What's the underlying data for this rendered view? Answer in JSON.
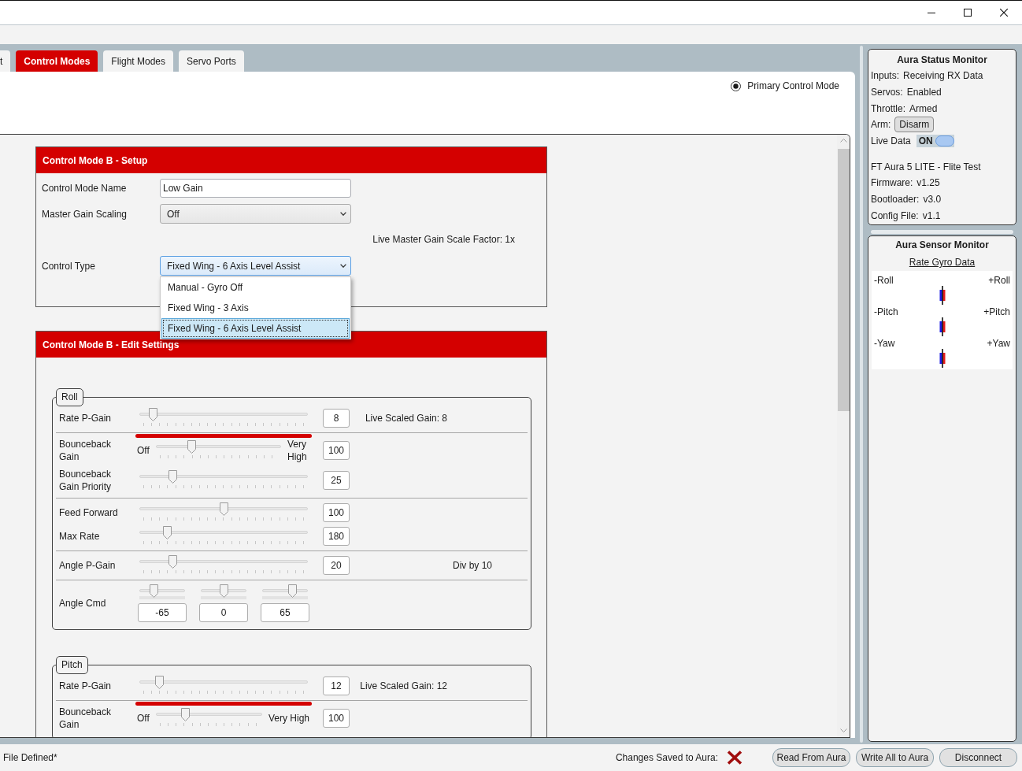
{
  "tabs": [
    {
      "label": "t",
      "selected": false
    },
    {
      "label": "Control Modes",
      "selected": true
    },
    {
      "label": "Flight Modes",
      "selected": false
    },
    {
      "label": "Servo Ports",
      "selected": false
    }
  ],
  "primary_control_mode": {
    "label": "Primary Control Mode",
    "selected": true
  },
  "setup_panel": {
    "title": "Control Mode B - Setup",
    "fields": [
      {
        "kind": "text",
        "label": "Control Mode Name",
        "value": "Low Gain"
      },
      {
        "kind": "dropdown",
        "label": "Master Gain Scaling",
        "value": "Off",
        "expanded": false
      },
      {
        "kind": "note",
        "value": "Live Master Gain Scale Factor: 1x"
      },
      {
        "kind": "dropdown",
        "label": "Control Type",
        "value": "Fixed Wing - 6 Axis Level Assist",
        "expanded": true,
        "options": [
          {
            "label": "Manual - Gyro Off",
            "selected": false
          },
          {
            "label": "Fixed Wing - 3 Axis",
            "selected": false
          },
          {
            "label": "Fixed Wing - 6 Axis Level Assist",
            "selected": true
          }
        ]
      }
    ]
  },
  "edit_panel": {
    "title": "Control Mode B - Edit Settings",
    "groups": [
      {
        "title": "Roll",
        "sections": [
          {
            "rows": [
              {
                "kind": "slider",
                "label": "Rate P-Gain",
                "level": 0.06,
                "value": "8",
                "note": "Live Scaled Gain: 8",
                "highlighted": true
              }
            ]
          },
          {
            "rows": [
              {
                "kind": "rangestacked",
                "label": "Bounceback Gain",
                "min_label": "Off",
                "max_label": "Very High",
                "level": 0.27,
                "value": "100"
              },
              {
                "kind": "slider",
                "label": "Bounceback Gain Priority",
                "level": 0.18,
                "value": "25",
                "highlighted": false
              }
            ]
          },
          {
            "rows": [
              {
                "kind": "slider",
                "label": "Feed Forward",
                "level": 0.5,
                "value": "100",
                "highlighted": false
              },
              {
                "kind": "slider",
                "label": "Max Rate",
                "level": 0.15,
                "value": "180",
                "highlighted": false
              }
            ]
          },
          {
            "rows": [
              {
                "kind": "slider",
                "label": "Angle P-Gain",
                "level": 0.18,
                "value": "20",
                "remark": "Div by 10",
                "highlighted": false
              }
            ]
          },
          {
            "rows": [
              {
                "kind": "triple",
                "label": "Angle Cmd",
                "sliders": [
                  {
                    "level": 0.27,
                    "value": "-65"
                  },
                  {
                    "level": 0.5,
                    "value": "0"
                  },
                  {
                    "level": 0.71,
                    "value": "65"
                  }
                ]
              }
            ]
          }
        ]
      },
      {
        "title": "Pitch",
        "sections": [
          {
            "rows": [
              {
                "kind": "slider",
                "label": "Rate P-Gain",
                "level": 0.1,
                "value": "12",
                "note": "Live Scaled Gain: 12",
                "highlighted": true
              }
            ]
          },
          {
            "rows": [
              {
                "kind": "rangeinline",
                "label": "Bounceback Gain",
                "min_label": "Off",
                "max_label": "Very High",
                "level": 0.26,
                "value": "100"
              }
            ]
          }
        ]
      }
    ]
  },
  "status_monitor": {
    "title": "Aura Status Monitor",
    "rows": [
      {
        "kind": "text",
        "label": "Inputs:",
        "value": "Receiving RX Data"
      },
      {
        "kind": "text",
        "label": "Servos:",
        "value": "Enabled"
      },
      {
        "kind": "text",
        "label": "Throttle:",
        "value": "Armed"
      },
      {
        "kind": "button",
        "label": "Arm:",
        "value": "Disarm"
      },
      {
        "kind": "toggle",
        "label": "Live Data",
        "value": "ON",
        "on": true
      }
    ],
    "device": {
      "name": "FT Aura 5 LITE - Flite Test",
      "versions": [
        {
          "label": "Firmware:",
          "value": "v1.25"
        },
        {
          "label": "Bootloader:",
          "value": "v3.0"
        },
        {
          "label": "Config File:",
          "value": "v1.1"
        }
      ]
    }
  },
  "sensor_monitor": {
    "title": "Aura Sensor Monitor",
    "subtitle": "Rate Gyro Data",
    "axes": [
      {
        "negative": "-Roll",
        "positive": "+Roll"
      },
      {
        "negative": "-Pitch",
        "positive": "+Pitch"
      },
      {
        "negative": "-Yaw",
        "positive": "+Yaw"
      }
    ]
  },
  "status_bar": {
    "file_status": "File Defined*",
    "save_status": {
      "label": "Changes Saved to Aura:",
      "saved": false
    },
    "buttons": [
      "Read From Aura",
      "Write All to Aura",
      "Disconnect"
    ]
  }
}
